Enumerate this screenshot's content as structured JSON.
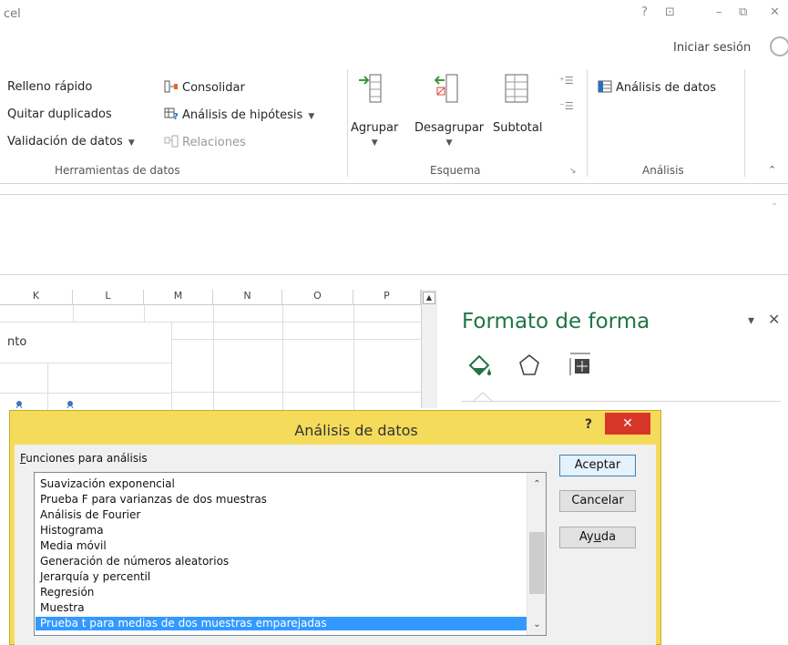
{
  "window": {
    "title_fragment": "cel",
    "controls": [
      "?",
      "⊡",
      "–",
      "⧉",
      "✕"
    ],
    "signin_label": "Iniciar sesión"
  },
  "ribbon": {
    "tools": {
      "flash_fill": "Relleno rápido",
      "remove_duplicates": "Quitar duplicados",
      "data_validation": "Validación de datos",
      "consolidate": "Consolidar",
      "what_if": "Análisis de hipótesis",
      "relationships": "Relaciones",
      "group_label": "Herramientas de datos"
    },
    "outline": {
      "group": "Agrupar",
      "ungroup": "Desagrupar",
      "subtotal": "Subtotal",
      "group_label": "Esquema"
    },
    "analysis": {
      "data_analysis": "Análisis de datos",
      "group_label": "Análisis"
    }
  },
  "sheet": {
    "columns": [
      "K",
      "L",
      "M",
      "N",
      "O",
      "P"
    ],
    "cell_fragment": "nto"
  },
  "format_pane": {
    "title": "Formato de forma"
  },
  "dialog": {
    "title": "Análisis de datos",
    "help_label": "?",
    "close_label": "✕",
    "list_label_access": "F",
    "list_label_rest": "unciones para análisis",
    "items": [
      "Suavización exponencial",
      "Prueba F para varianzas de dos muestras",
      "Análisis de Fourier",
      "Histograma",
      "Media móvil",
      "Generación de números aleatorios",
      "Jerarquía y percentil",
      "Regresión",
      "Muestra",
      "Prueba t para medias de dos muestras emparejadas"
    ],
    "selected_item": "Prueba t para medias de dos muestras emparejadas",
    "buttons": {
      "ok": "Aceptar",
      "cancel": "Cancelar",
      "help_pre": "Ay",
      "help_access": "u",
      "help_post": "da"
    }
  },
  "colors": {
    "excel_green": "#217346",
    "dialog_frame": "#f5db5a",
    "close_red": "#d9362a",
    "selection_blue": "#3399ff"
  }
}
